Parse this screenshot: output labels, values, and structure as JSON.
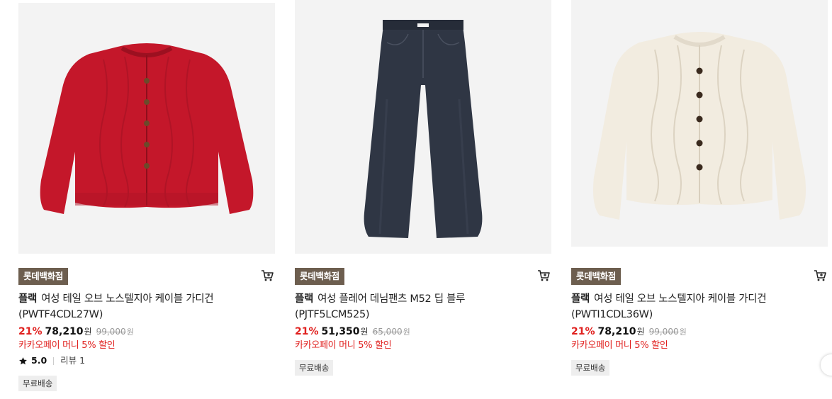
{
  "products": [
    {
      "store_badge": "롯데백화점",
      "brand": "플랙",
      "name": "여성 테일 오브 노스텔지아 케이블 가디건",
      "code": "(PWTF4CDL27W)",
      "discount": "21%",
      "price": "78,210",
      "price_unit": "원",
      "original_price": "99,000",
      "original_unit": "원",
      "promo": "카카오페이 머니 5% 할인",
      "rating": "5.0",
      "review": "리뷰 1",
      "shipping": "무료배송",
      "icon": "red-cable-cardigan",
      "color": "#c4172a"
    },
    {
      "store_badge": "롯데백화점",
      "brand": "플랙",
      "name": "여성 플레어 데님팬츠 M52 딥 블루",
      "code": "(PJTF5LCM525)",
      "discount": "21%",
      "price": "51,350",
      "price_unit": "원",
      "original_price": "65,000",
      "original_unit": "원",
      "promo": "카카오페이 머니 5% 할인",
      "shipping": "무료배송",
      "icon": "denim-pants",
      "color": "#2f3644"
    },
    {
      "store_badge": "롯데백화점",
      "brand": "플랙",
      "name": "여성 테일 오브 노스텔지아 케이블 가디건",
      "code": "(PWTI1CDL36W)",
      "discount": "21%",
      "price": "78,210",
      "price_unit": "원",
      "original_price": "99,000",
      "original_unit": "원",
      "promo": "카카오페이 머니 5% 할인",
      "shipping": "무료배송",
      "icon": "ivory-cable-cardigan",
      "color": "#f2ece0"
    }
  ],
  "colors": {
    "badge_bg": "#6d5e4f",
    "discount": "#e0201e",
    "thumb_bg": "#f3f3f3"
  }
}
